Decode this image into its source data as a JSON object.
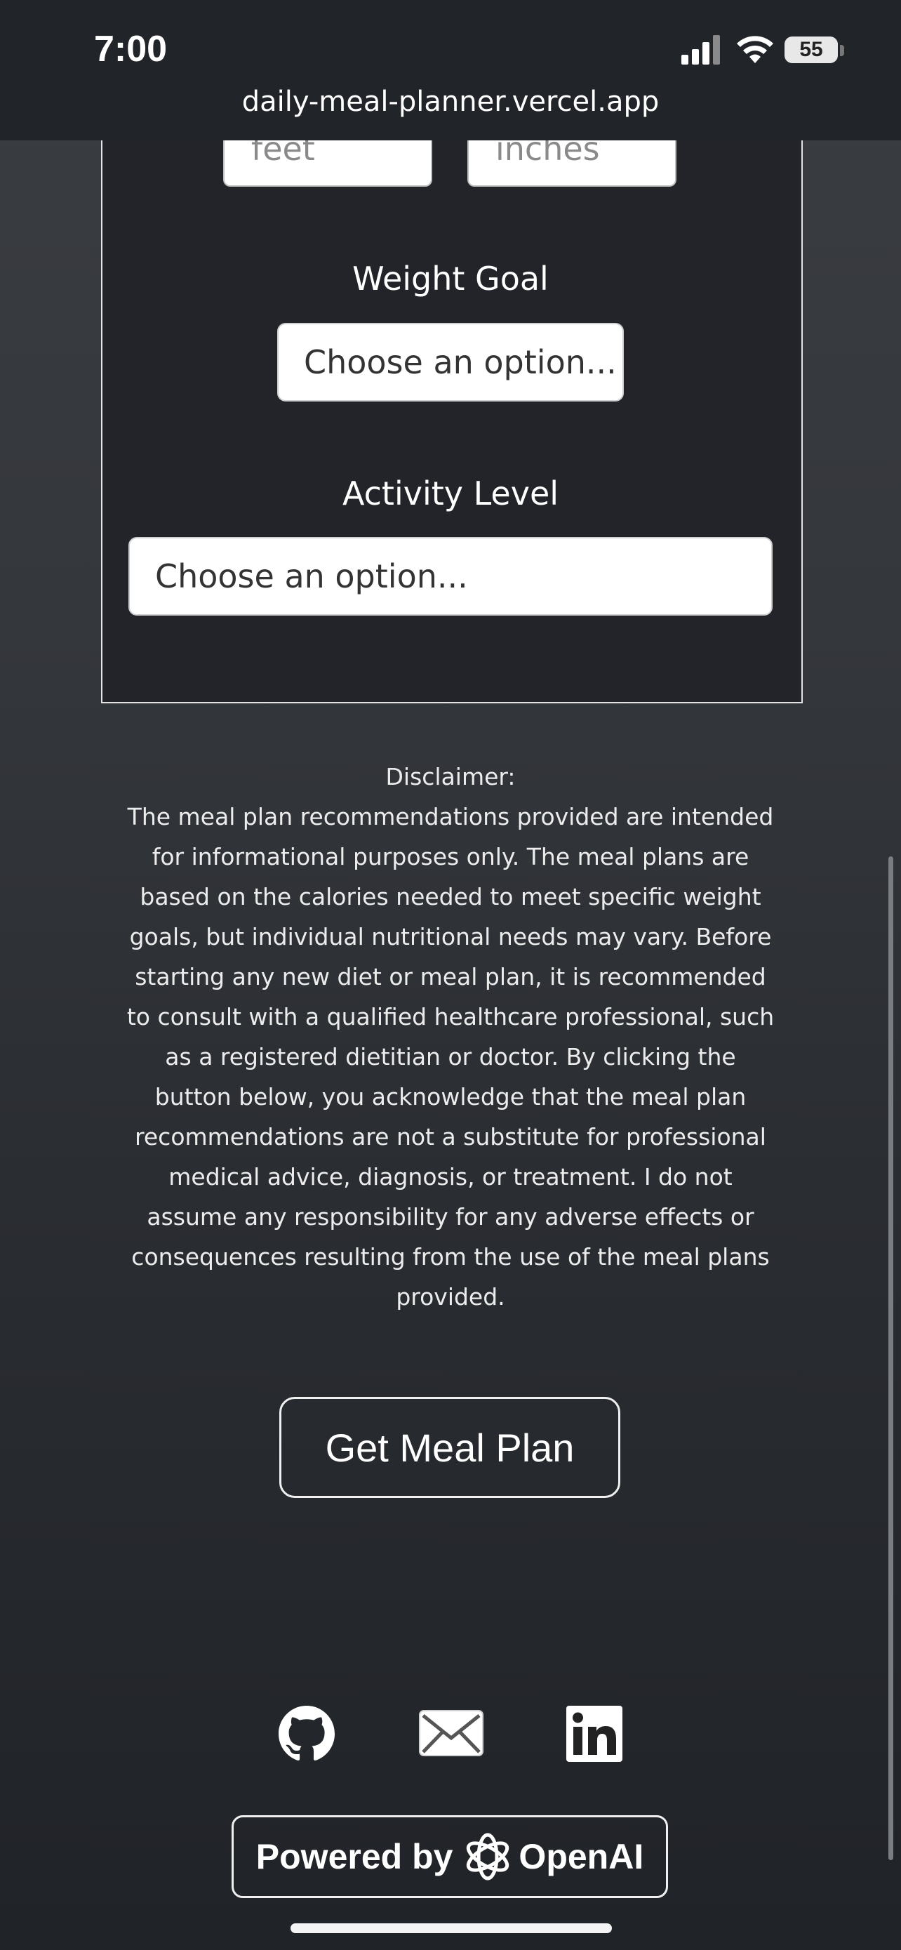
{
  "status_bar": {
    "time": "7:00",
    "battery": "55",
    "signal_icon": "cellular-signal-icon",
    "wifi_icon": "wifi-icon"
  },
  "browser": {
    "url": "daily-meal-planner.vercel.app"
  },
  "form": {
    "height_feet_placeholder": "feet",
    "height_inches_placeholder": "inches",
    "weight_goal_label": "Weight Goal",
    "weight_goal_value": "Choose an option...",
    "activity_level_label": "Activity Level",
    "activity_level_value": "Choose an option..."
  },
  "disclaimer": {
    "title": "Disclaimer:",
    "body": "The meal plan recommendations provided are intended for informational purposes only. The meal plans are based on the calories needed to meet specific weight goals, but individual nutritional needs may vary. Before starting any new diet or meal plan, it is recommended to consult with a qualified healthcare professional, such as a registered dietitian or doctor. By clicking the button below, you acknowledge that the meal plan recommendations are not a substitute for professional medical advice, diagnosis, or treatment. I do not assume any responsibility for any adverse effects or consequences resulting from the use of the meal plans provided."
  },
  "actions": {
    "get_meal_plan": "Get Meal Plan"
  },
  "footer": {
    "social": [
      "github-icon",
      "mail-icon",
      "linkedin-icon"
    ],
    "powered_by": "Powered by",
    "powered_brand": "OpenAI"
  },
  "colors": {
    "background": "#2f3237",
    "card": "#222429",
    "status_bar": "#212428"
  }
}
